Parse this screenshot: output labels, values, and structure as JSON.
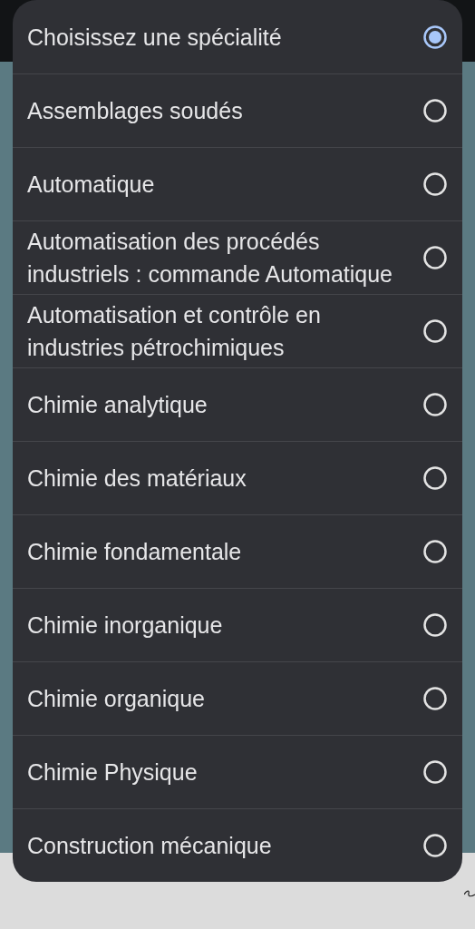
{
  "options": [
    {
      "label": "Choisissez une spécialité",
      "selected": true
    },
    {
      "label": "Assemblages soudés",
      "selected": false
    },
    {
      "label": "Automatique",
      "selected": false
    },
    {
      "label": "Automatisation des procédés industriels : commande Automatique",
      "selected": false
    },
    {
      "label": "Automatisation et contrôle en industries pétrochimiques",
      "selected": false
    },
    {
      "label": "Chimie analytique",
      "selected": false
    },
    {
      "label": "Chimie des matériaux",
      "selected": false
    },
    {
      "label": "Chimie fondamentale",
      "selected": false
    },
    {
      "label": "Chimie inorganique",
      "selected": false
    },
    {
      "label": "Chimie organique",
      "selected": false
    },
    {
      "label": "Chimie Physique",
      "selected": false
    },
    {
      "label": "Construction mécanique",
      "selected": false
    }
  ]
}
